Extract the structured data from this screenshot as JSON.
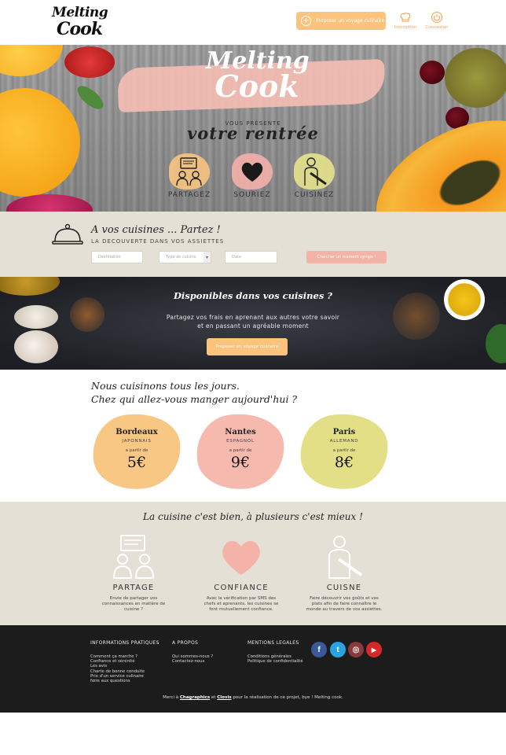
{
  "header": {
    "logo_line1": "Melting",
    "logo_line2": "Cook",
    "propose_label": "Proposer un voyage culinaire",
    "signup_label": "Inscription",
    "login_label": "Connexion"
  },
  "hero": {
    "logo_line1": "Melting",
    "logo_line2": "Cook",
    "presents": "VOUS PRÉSENTE",
    "title": "votre rentrée",
    "features": [
      {
        "label": "PARTAGEZ",
        "icon": "chat-people-icon"
      },
      {
        "label": "SOURIEZ",
        "icon": "heart-icon"
      },
      {
        "label": "CUISINEZ",
        "icon": "chef-knife-icon"
      }
    ]
  },
  "search": {
    "title": "A vos cuisines ... Partez !",
    "subtitle": "LA DECOUVERTE DANS VOS ASSIETTES",
    "destination_placeholder": "Destination",
    "cuisine_type_value": "Type de cuisine",
    "date_placeholder": "Date",
    "submit_label": "Chercher un moment sympa !"
  },
  "banner": {
    "title": "Disponibles dans vos cuisines ?",
    "text_line1": "Partagez vos frais en aprenant aux autres votre savoir",
    "text_line2": "et en passant un agréable moment",
    "button_label": "Proposer un voyage culinaire"
  },
  "cities": {
    "title_line1": "Nous cuisinons tous les jours.",
    "title_line2": "Chez qui allez-vous manger aujourd'hui ?",
    "items": [
      {
        "name": "Bordeaux",
        "cuisine": "JAPONNAIS",
        "from": "a partir de",
        "price": "5€",
        "color": "#f9c784"
      },
      {
        "name": "Nantes",
        "cuisine": "ESPAGNOL",
        "from": "a partir de",
        "price": "9€",
        "color": "#f5b9ad"
      },
      {
        "name": "Paris",
        "cuisine": "ALLEMAND",
        "from": "a partir de",
        "price": "8€",
        "color": "#e2df86"
      }
    ]
  },
  "values": {
    "title": "La cuisine c'est bien, à plusieurs c'est mieux !",
    "items": [
      {
        "title": "PARTAGE",
        "desc": [
          "Envie de partager vos",
          "connaissances en matière de",
          "cuisine ?"
        ]
      },
      {
        "title": "CONFIANCE",
        "desc": [
          "Avec la vérification par SMS des",
          "chefs et aprenants, les cuisines se",
          "font mutuellement confiance."
        ]
      },
      {
        "title": "CUISNE",
        "desc": [
          "Faire découvrir vos goûts et vos",
          "plats afin de faire connaître le",
          "monde au travers de vos assiettes."
        ]
      }
    ]
  },
  "footer": {
    "col1_title": "INFORMATIONS PRATIQUES",
    "col1_links": [
      "Comment ça marche ?",
      "Confiance et sérénité",
      "Les avis",
      "Charte de bonne conduite",
      "Prix d'un service culinaire",
      "foire aux questions"
    ],
    "col2_title": "A PROPOS",
    "col2_links": [
      "Qui sommes-nous ?",
      "Contactez-nous"
    ],
    "col3_title": "MENTIONS LEGALES",
    "col3_links": [
      "Conditions générales",
      "Politique de confidentialité"
    ],
    "social": [
      {
        "name": "facebook-icon",
        "glyph": "f",
        "color": "#3b5998"
      },
      {
        "name": "twitter-icon",
        "glyph": "t",
        "color": "#2aa3e0"
      },
      {
        "name": "instagram-icon",
        "glyph": "◎",
        "color": "#8a3a3a"
      },
      {
        "name": "youtube-icon",
        "glyph": "▶",
        "color": "#d62828"
      }
    ],
    "credits_pre": "Merci à",
    "credits_a": "Chagraphics",
    "credits_mid": "et",
    "credits_b": "Clovis",
    "credits_post": "pour la réalisation de ce projet, bye ! Melting cook."
  }
}
